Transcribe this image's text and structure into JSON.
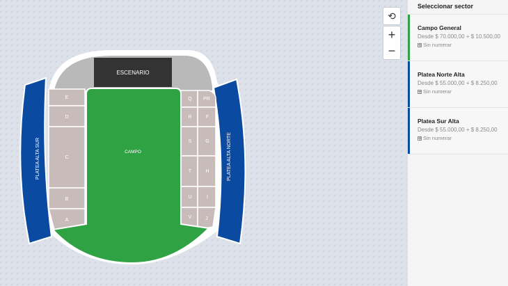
{
  "map": {
    "stage_label": "ESCENARIO",
    "field_label": "CAMPO",
    "left_stand_label": "PLATEA ALTA SUR",
    "right_stand_label": "PLATEA ALTA NORTE",
    "left_sections": [
      "E",
      "D",
      "C",
      "B",
      "A"
    ],
    "right_inner_sections": [
      "Q",
      "R",
      "S",
      "T",
      "U",
      "V"
    ],
    "right_outer_sections": [
      "PR",
      "F",
      "G",
      "H",
      "I",
      "J"
    ],
    "colors": {
      "field": "#2fa344",
      "stands": "#0a4aa0",
      "sections": "#c7bcba",
      "stage": "#333333",
      "bowl": "#b9b9b9"
    }
  },
  "controls": {
    "reset": "⟲",
    "zoom_in": "+",
    "zoom_out": "−"
  },
  "sidebar": {
    "title": "Seleccionar sector",
    "sectors": [
      {
        "name": "Campo General",
        "price": "Desde $ 70.000,00 + $ 10.500,00",
        "seating": "Sin numerar",
        "color": "#2fa344"
      },
      {
        "name": "Platea Norte Alta",
        "price": "Desde $ 55.000,00 + $ 8.250,00",
        "seating": "Sin numerar",
        "color": "#0a4aa0"
      },
      {
        "name": "Platea Sur Alta",
        "price": "Desde $ 55.000,00 + $ 8.250,00",
        "seating": "Sin numerar",
        "color": "#0a4aa0"
      }
    ]
  }
}
